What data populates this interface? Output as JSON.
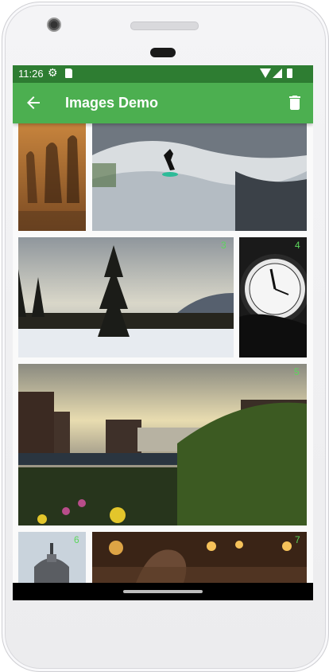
{
  "status_bar": {
    "time": "11:26",
    "icons": [
      "settings-gear-icon",
      "sd-card-icon",
      "wifi-icon",
      "signal-icon",
      "battery-icon"
    ]
  },
  "app_bar": {
    "title": "Images Demo",
    "back_icon": "arrow-back-icon",
    "action_icon": "delete-icon"
  },
  "colors": {
    "status_bar": "#2e7d32",
    "app_bar": "#4caf50",
    "tile_number": "#5cd65c"
  },
  "images": [
    {
      "id": "1",
      "label": "",
      "subject": "shadows on rock"
    },
    {
      "id": "2",
      "label": "",
      "subject": "river surfer"
    },
    {
      "id": "3",
      "label": "3",
      "subject": "pine tree at sunset"
    },
    {
      "id": "4",
      "label": "4",
      "subject": "clock face"
    },
    {
      "id": "5",
      "label": "5",
      "subject": "city skyline with garden"
    },
    {
      "id": "6",
      "label": "6",
      "subject": "domed building"
    },
    {
      "id": "7",
      "label": "7",
      "subject": "lights at night"
    }
  ]
}
